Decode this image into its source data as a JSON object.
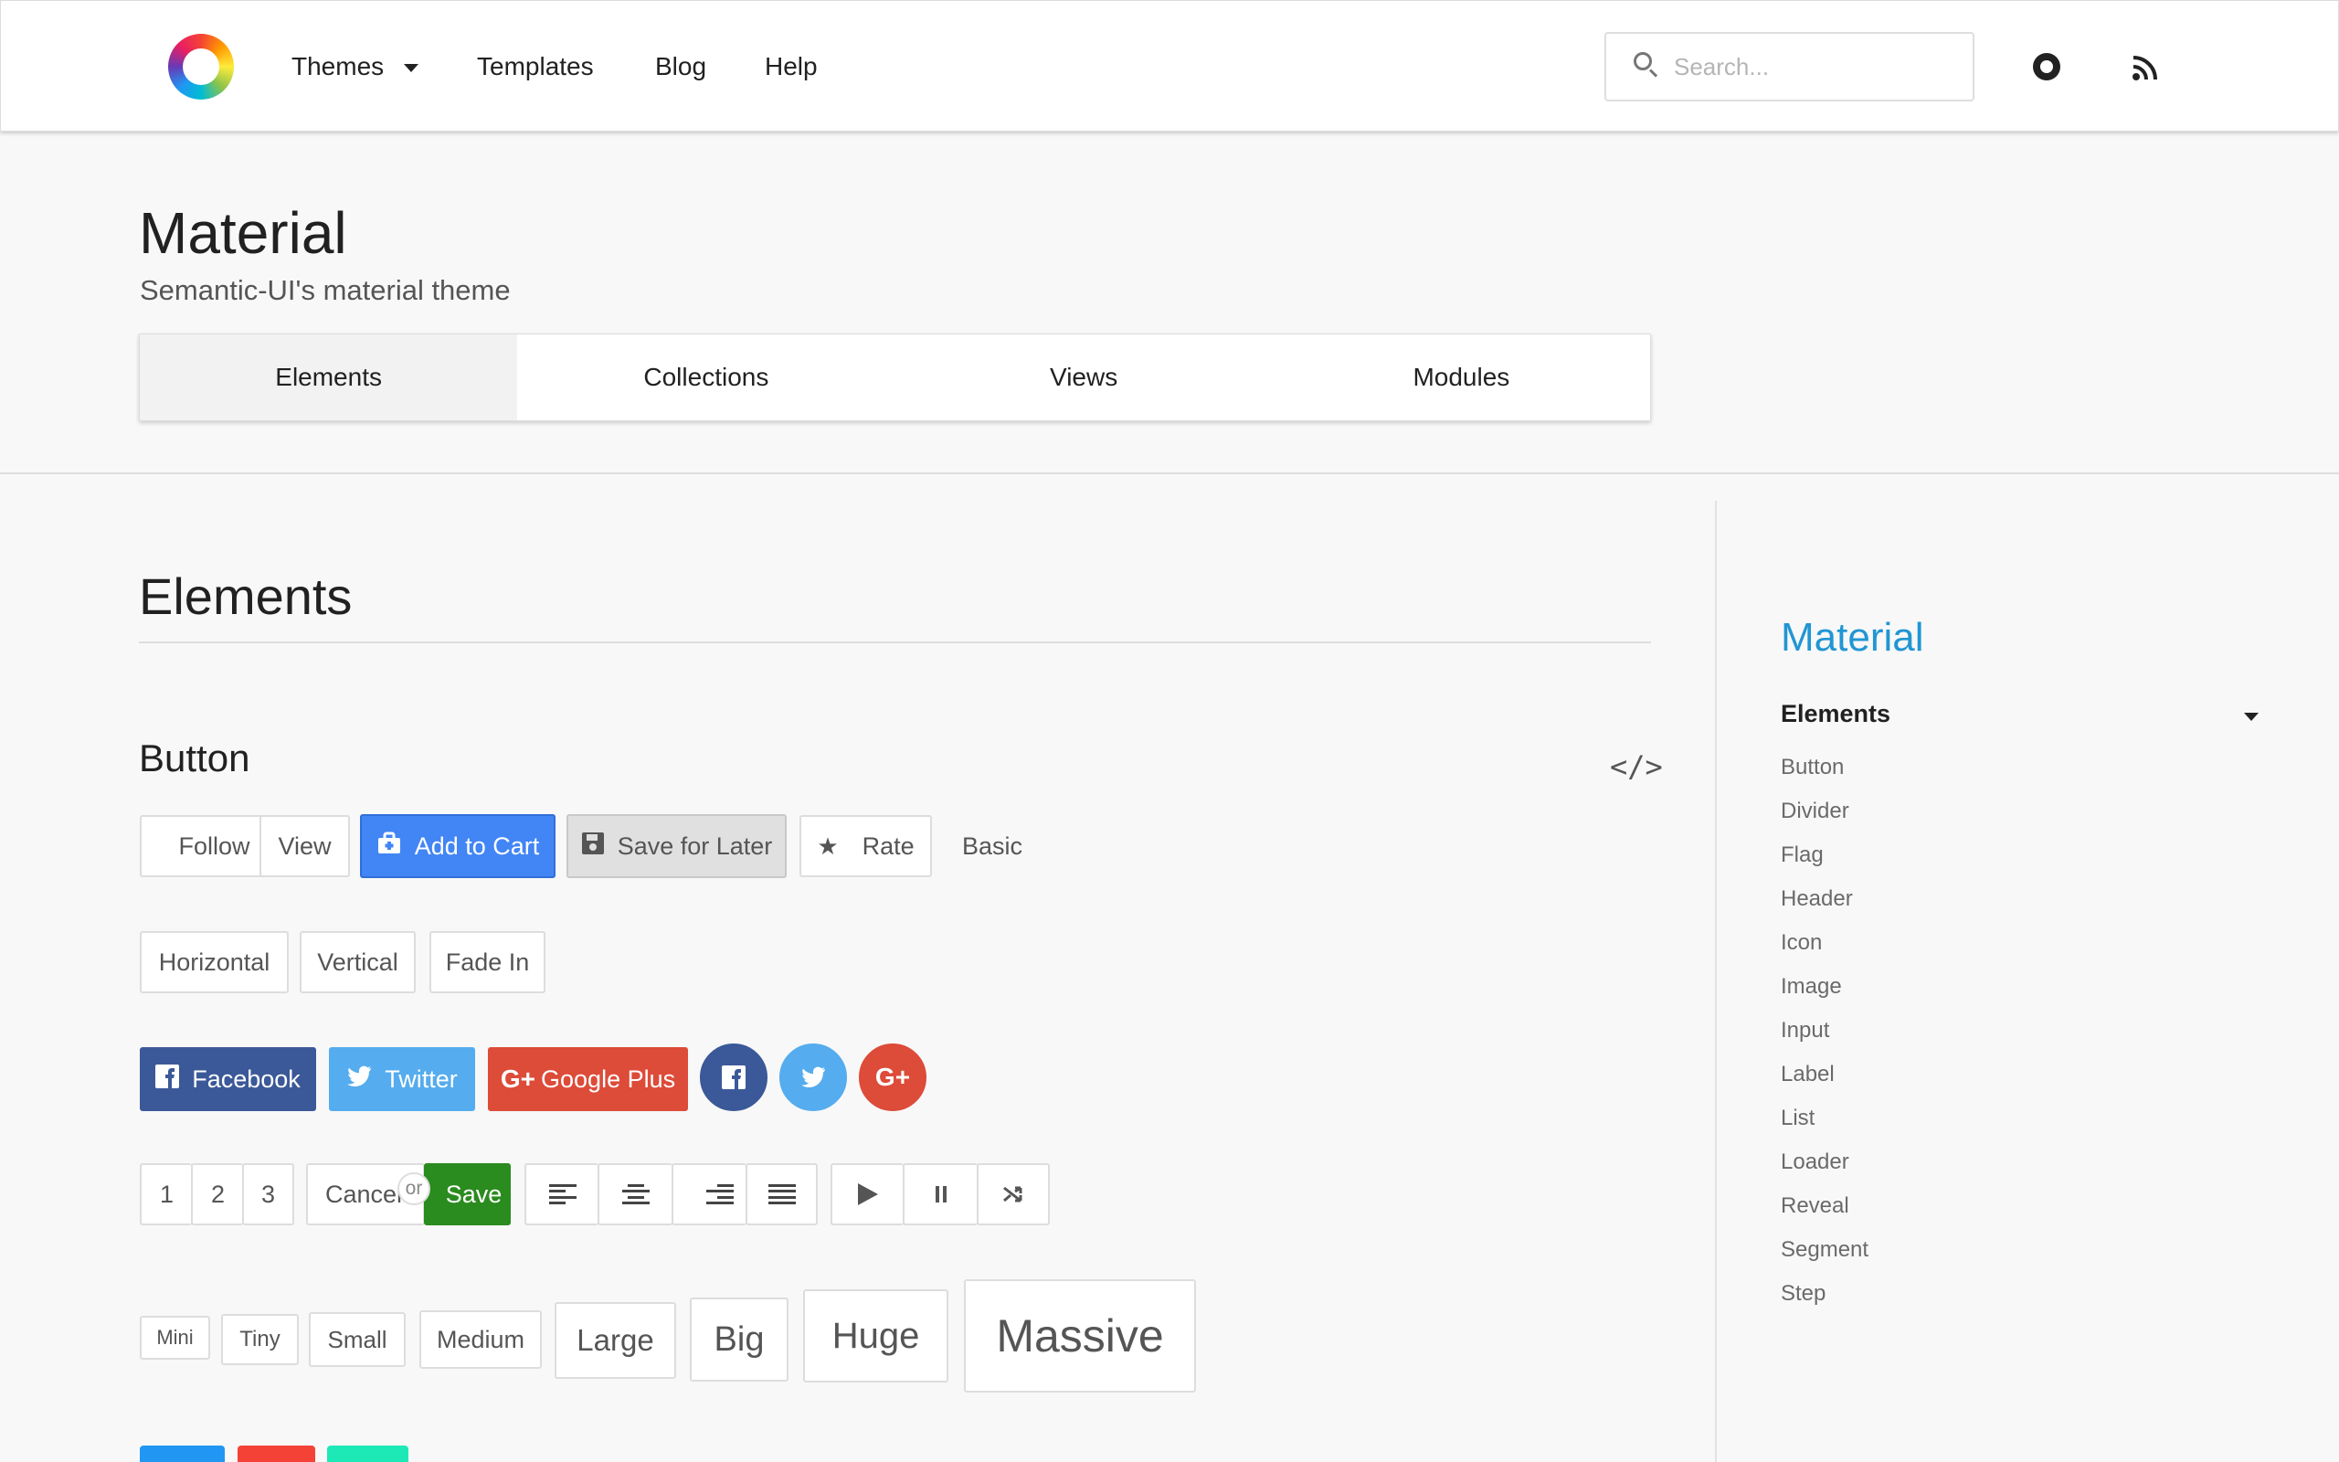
{
  "nav": {
    "items": [
      "Themes",
      "Templates",
      "Blog",
      "Help"
    ],
    "search_placeholder": "Search..."
  },
  "header": {
    "title": "Material",
    "subtitle": "Semantic-UI's material theme",
    "tabs": [
      "Elements",
      "Collections",
      "Views",
      "Modules"
    ],
    "active_tab": "Elements"
  },
  "main": {
    "section_title": "Elements",
    "subsection_title": "Button",
    "code_icon": "</>",
    "row1": [
      "Follow",
      "View",
      "Add to Cart",
      "Save for Later",
      "Rate",
      "Basic"
    ],
    "row2": [
      "Horizontal",
      "Vertical",
      "Fade In"
    ],
    "social": [
      "Facebook",
      "Twitter",
      "Google Plus"
    ],
    "pages": [
      "1",
      "2",
      "3"
    ],
    "cancel": "Cancel",
    "or": "or",
    "save": "Save",
    "sizes": [
      "Mini",
      "Tiny",
      "Small",
      "Medium",
      "Large",
      "Big",
      "Huge",
      "Massive"
    ]
  },
  "sidebar": {
    "title": "Material",
    "section": "Elements",
    "items": [
      "Button",
      "Divider",
      "Flag",
      "Header",
      "Icon",
      "Image",
      "Input",
      "Label",
      "List",
      "Loader",
      "Reveal",
      "Segment",
      "Step"
    ]
  },
  "colors": {
    "accent": "#2196d3",
    "primary_button": "#4285f4",
    "facebook": "#3b5998",
    "twitter": "#55acee",
    "google_plus": "#dd4b39",
    "save": "#2a8b1e"
  }
}
